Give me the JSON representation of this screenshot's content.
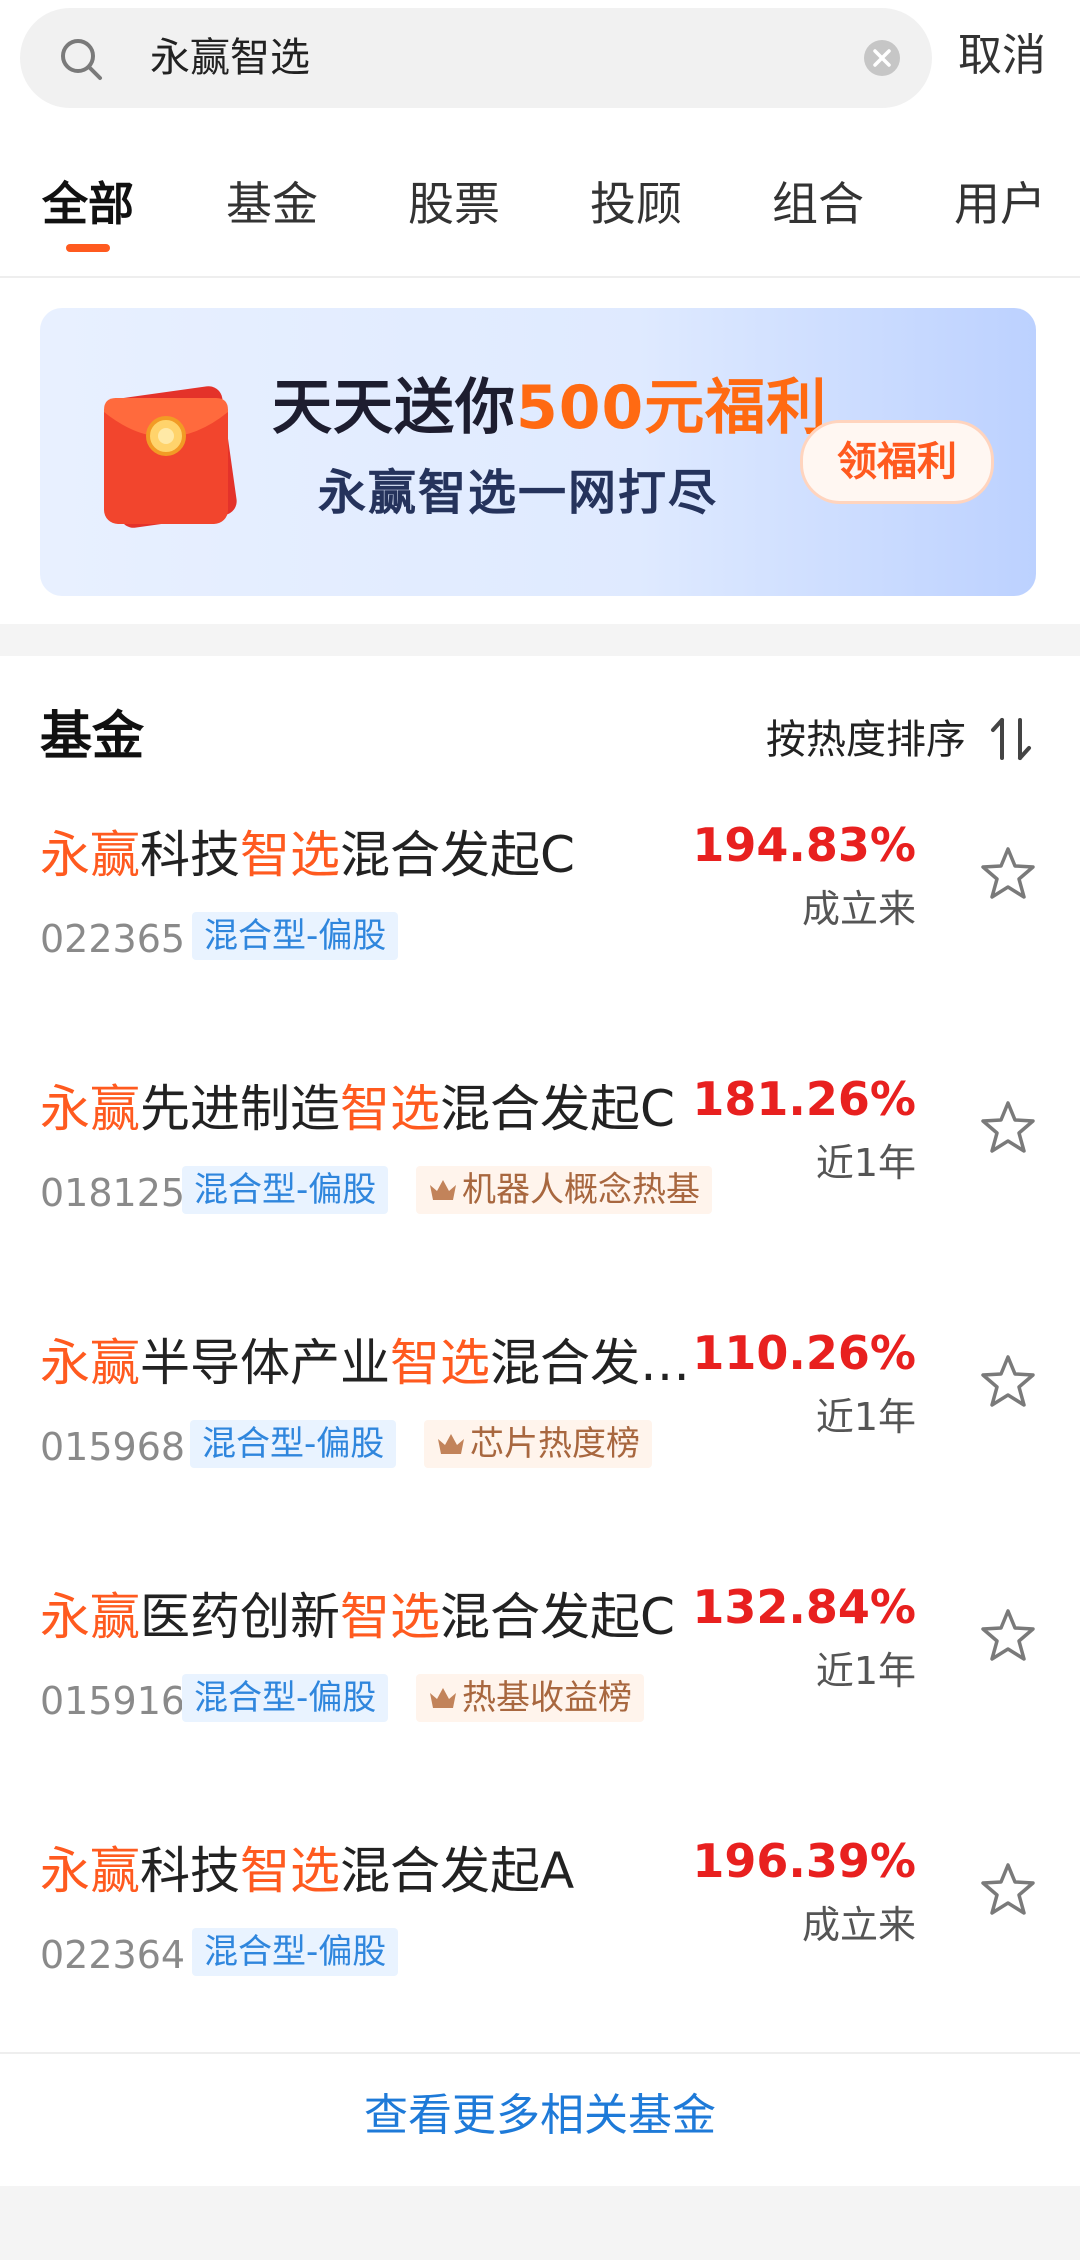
{
  "search": {
    "query": "永赢智选",
    "cancel_label": "取消"
  },
  "tabs": [
    {
      "label": "全部",
      "active": true
    },
    {
      "label": "基金",
      "active": false
    },
    {
      "label": "股票",
      "active": false
    },
    {
      "label": "投顾",
      "active": false
    },
    {
      "label": "组合",
      "active": false
    },
    {
      "label": "用户",
      "active": false
    }
  ],
  "banner": {
    "line1_prefix": "天天送你",
    "line1_highlight": "500元福利",
    "line2": "永赢智选一网打尽",
    "button_label": "领福利"
  },
  "fund_section": {
    "title": "基金",
    "sort_label": "按热度排序",
    "more_link": "查看更多相关基金",
    "funds": [
      {
        "name_parts": [
          "永赢",
          "科技",
          "智选",
          "混合发起C"
        ],
        "code": "022365",
        "type_tag": "混合型-偏股",
        "rank_tag": "",
        "return": "194.83%",
        "period": "成立来"
      },
      {
        "name_parts": [
          "永赢",
          "先进制造",
          "智选",
          "混合发起C"
        ],
        "code": "018125",
        "type_tag": "混合型-偏股",
        "rank_tag": "机器人概念热基",
        "return": "181.26%",
        "period": "近1年"
      },
      {
        "name_parts": [
          "永赢",
          "半导体产业",
          "智选",
          "混合发…"
        ],
        "code": "015968",
        "type_tag": "混合型-偏股",
        "rank_tag": "芯片热度榜",
        "return": "110.26%",
        "period": "近1年"
      },
      {
        "name_parts": [
          "永赢",
          "医药创新",
          "智选",
          "混合发起C"
        ],
        "code": "015916",
        "type_tag": "混合型-偏股",
        "rank_tag": "热基收益榜",
        "return": "132.84%",
        "period": "近1年"
      },
      {
        "name_parts": [
          "永赢",
          "科技",
          "智选",
          "混合发起A"
        ],
        "code": "022364",
        "type_tag": "混合型-偏股",
        "rank_tag": "",
        "return": "196.39%",
        "period": "成立来"
      }
    ]
  },
  "colors": {
    "keyword": "#ff5a1f",
    "return_red": "#e8201f",
    "link_blue": "#1e7ad8",
    "tag_blue": "#2f86dd"
  },
  "icons": [
    "search-icon",
    "clear-icon",
    "red-envelope-icon",
    "sort-icon",
    "crown-icon",
    "star-icon"
  ]
}
